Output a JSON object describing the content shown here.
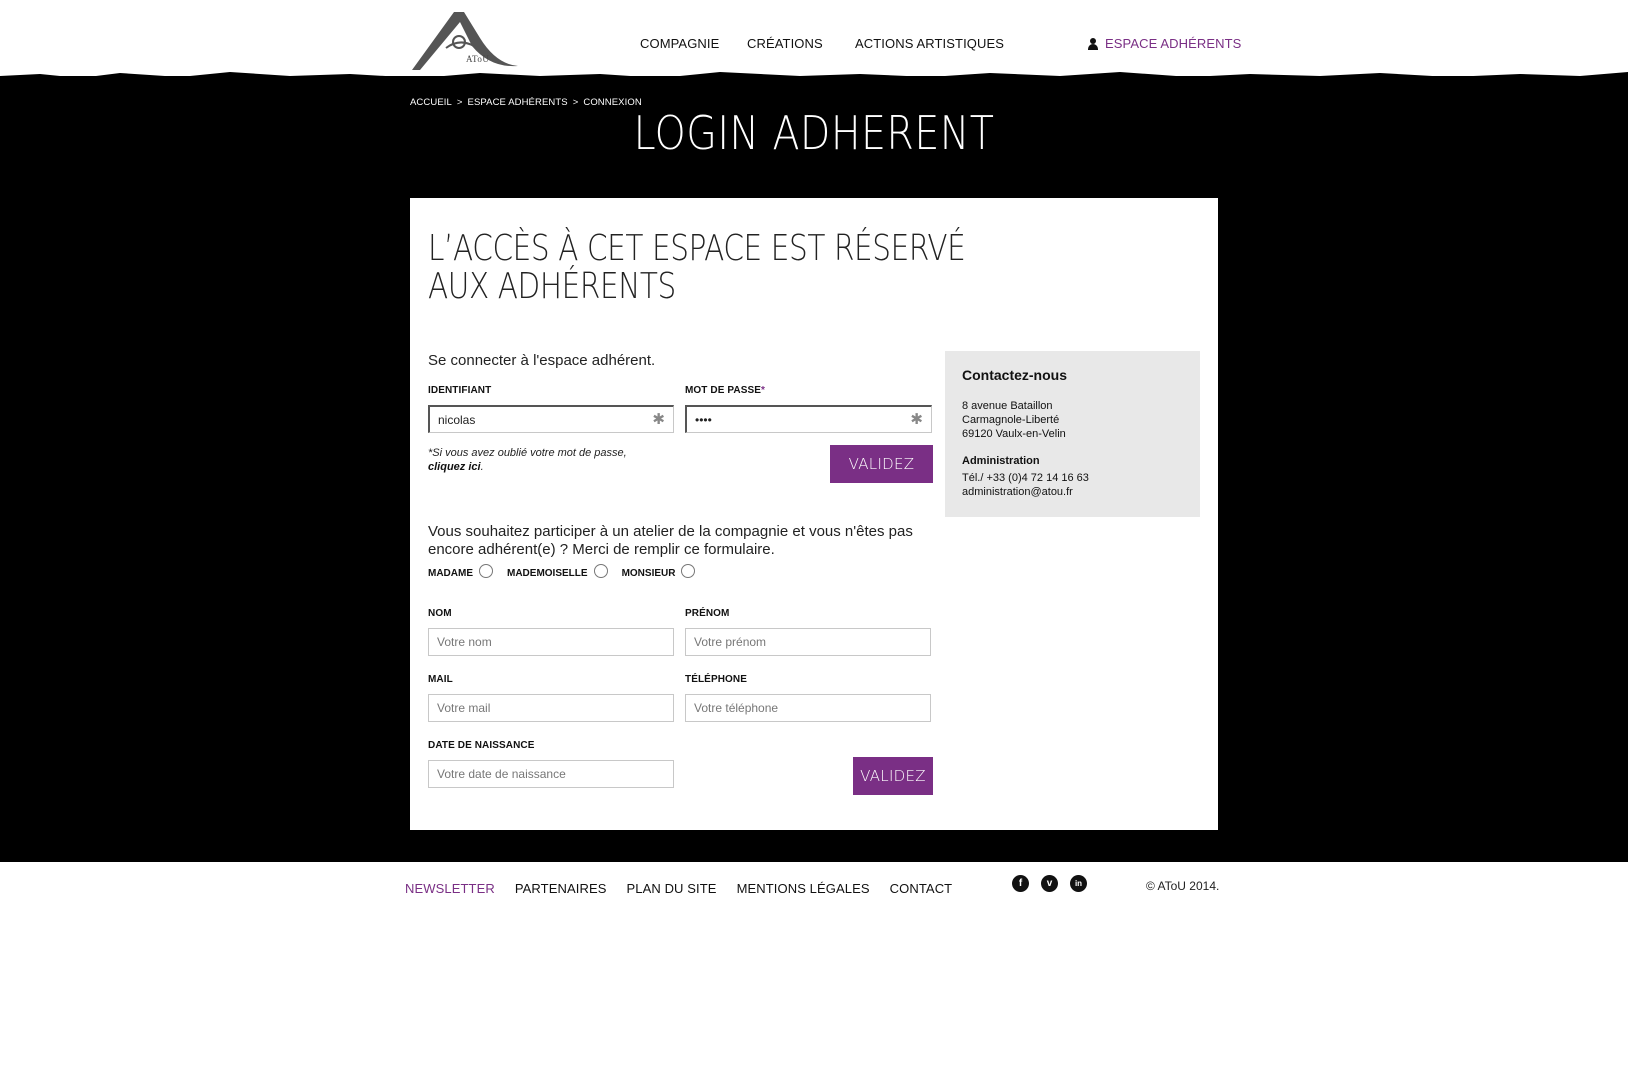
{
  "logo": {
    "text": "AToU"
  },
  "nav": {
    "compagnie": "COMPAGNIE",
    "creations": "CRÉATIONS",
    "actions": "ACTIONS ARTISTIQUES",
    "espace": "ESPACE ADHÉRENTS"
  },
  "breadcrumb": [
    "ACCUEIL",
    ">",
    "ESPACE ADHÉRENTS",
    ">",
    "CONNEXION"
  ],
  "page_title": "LOGIN ADHERENT",
  "headline": "L’ACCÈS À CET ESPACE EST RÉSERVÉ AUX ADHÉRENTS",
  "login": {
    "intro": "Se connecter à l'espace adhérent.",
    "identifiant_label": "IDENTIFIANT",
    "identifiant_value": "nicolas",
    "password_label": "MOT DE PASSE",
    "password_required": "*",
    "password_value": "••••",
    "field_marker": "✱",
    "forgot_text": "*Si vous avez oublié votre mot de passe,",
    "forgot_link": "cliquez ici",
    "forgot_end": ".",
    "submit": "VALIDEZ"
  },
  "register": {
    "intro": "Vous souhaitez participer à un atelier de la compagnie et vous n'êtes pas encore adhérent(e) ? Merci de remplir ce formulaire.",
    "civilities": [
      "MADAME",
      "MADEMOISELLE",
      "MONSIEUR"
    ],
    "nom_label": "NOM",
    "nom_placeholder": "Votre nom",
    "prenom_label": "PRÉNOM",
    "prenom_placeholder": "Votre prénom",
    "mail_label": "MAIL",
    "mail_placeholder": "Votre mail",
    "telephone_label": "TÉLÉPHONE",
    "telephone_placeholder": "Votre téléphone",
    "naissance_label": "DATE DE NAISSANCE",
    "naissance_placeholder": "Votre date de naissance",
    "submit": "VALIDEZ"
  },
  "contact": {
    "title": "Contactez-nous",
    "address": [
      "8 avenue Bataillon",
      "Carmagnole-Liberté",
      "69120 Vaulx-en-Velin"
    ],
    "admin_title": "Administration",
    "admin_lines": [
      "Tél./ +33 (0)4 72 14 16 63",
      "administration@atou.fr"
    ]
  },
  "footer": {
    "links": [
      "NEWSLETTER",
      "PARTENAIRES",
      "PLAN DU SITE",
      "MENTIONS LÉGALES",
      "CONTACT"
    ],
    "social": [
      "f",
      "v",
      "in"
    ],
    "copyright": "© AToU 2014."
  },
  "colors": {
    "accent": "#7a2f85",
    "band": "#000000",
    "contact_bg": "#e8e8e8"
  },
  "icons": {
    "user": "user-icon",
    "facebook": "facebook-icon",
    "vimeo": "vimeo-icon",
    "linkedin": "linkedin-icon"
  }
}
